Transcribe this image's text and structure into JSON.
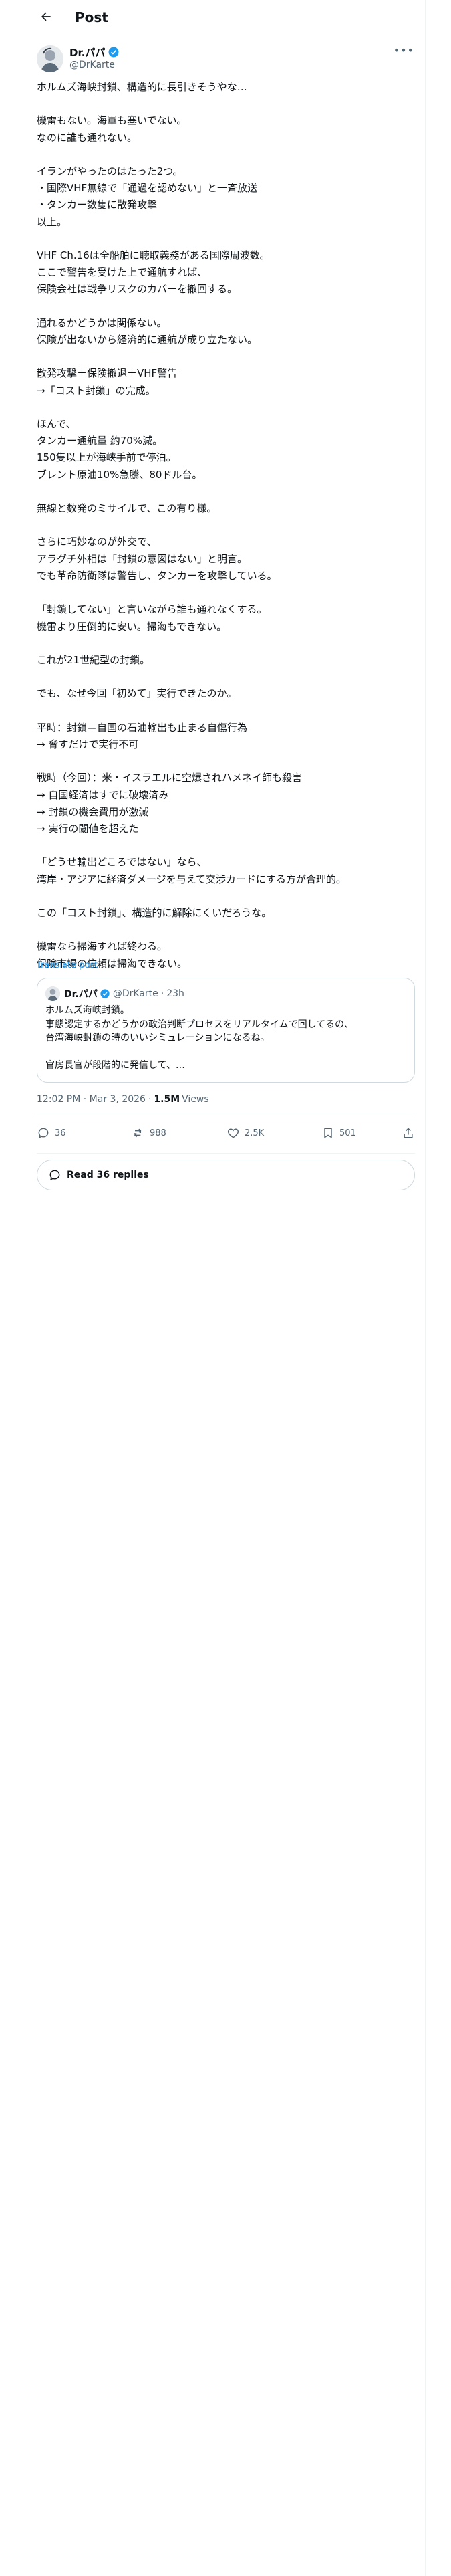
{
  "header": {
    "title": "Post",
    "back_icon": "arrow-left-icon"
  },
  "author": {
    "name": "Dr.パパ",
    "handle": "@DrKarte",
    "verified_color": "#1d9bf0"
  },
  "post": {
    "body": "ホルムズ海峡封鎖、構造的に長引きそうやな…\n\n機雷もない。海軍も塞いでない。\nなのに誰も通れない。\n\nイランがやったのはたった2つ。\n・国際VHF無線で「通過を認めない」と一斉放送\n・タンカー数隻に散発攻撃\n以上。\n\nVHF Ch.16は全船舶に聴取義務がある国際周波数。\nここで警告を受けた上で通航すれば、\n保険会社は戦争リスクのカバーを撤回する。\n\n通れるかどうかは関係ない。\n保険が出ないから経済的に通航が成り立たない。\n\n散発攻撃＋保険撤退＋VHF警告\n→「コスト封鎖」の完成。\n\nほんで、\nタンカー通航量 約70%減。\n150隻以上が海峡手前で停泊。\nブレント原油10%急騰、80ドル台。\n\n無線と数発のミサイルで、この有り様。\n\nさらに巧妙なのが外交で、\nアラグチ外相は「封鎖の意図はない」と明言。\nでも革命防衛隊は警告し、タンカーを攻撃している。\n\n「封鎖してない」と言いながら誰も通れなくする。\n機雷より圧倒的に安い。掃海もできない。\n\nこれが21世紀型の封鎖。\n\nでも、なぜ今回「初めて」実行できたのか。\n\n平時：封鎖＝自国の石油輸出も止まる自傷行為\n→ 脅すだけで実行不可\n\n戦時（今回）：米・イスラエルに空爆されハメネイ師も殺害\n→ 自国経済はすでに破壊済み\n→ 封鎖の機会費用が激減\n→ 実行の閾値を超えた\n\n「どうせ輸出どころではない」なら、\n湾岸・アジアに経済ダメージを与えて交渉カードにする方が合理的。\n\nこの「コスト封鎖」、構造的に解除にくいだろうな。\n\n機雷なら掃海すれば終わる。\n保険市場の信頼は掃海できない。",
    "translate_label": "Translate post",
    "time": "12:02 PM · Mar 3, 2026",
    "views_count": "1.5M",
    "views_label": "Views"
  },
  "quote": {
    "name": "Dr.パパ",
    "handle": "@DrKarte",
    "time": "23h",
    "text": "ホルムズ海峡封鎖。\n事態認定するかどうかの政治判断プロセスをリアルタイムで回してるの、\n台湾海峡封鎖の時のいいシミュレーションになるね。\n\n官房長官が段階的に発信して、…"
  },
  "actions": {
    "replies": "36",
    "reposts": "988",
    "likes": "2.5K",
    "bookmarks": "501"
  },
  "read_replies": {
    "label": "Read 36 replies"
  },
  "colors": {
    "accent": "#1d9bf0",
    "muted": "#536471",
    "border": "#cfd9de"
  }
}
